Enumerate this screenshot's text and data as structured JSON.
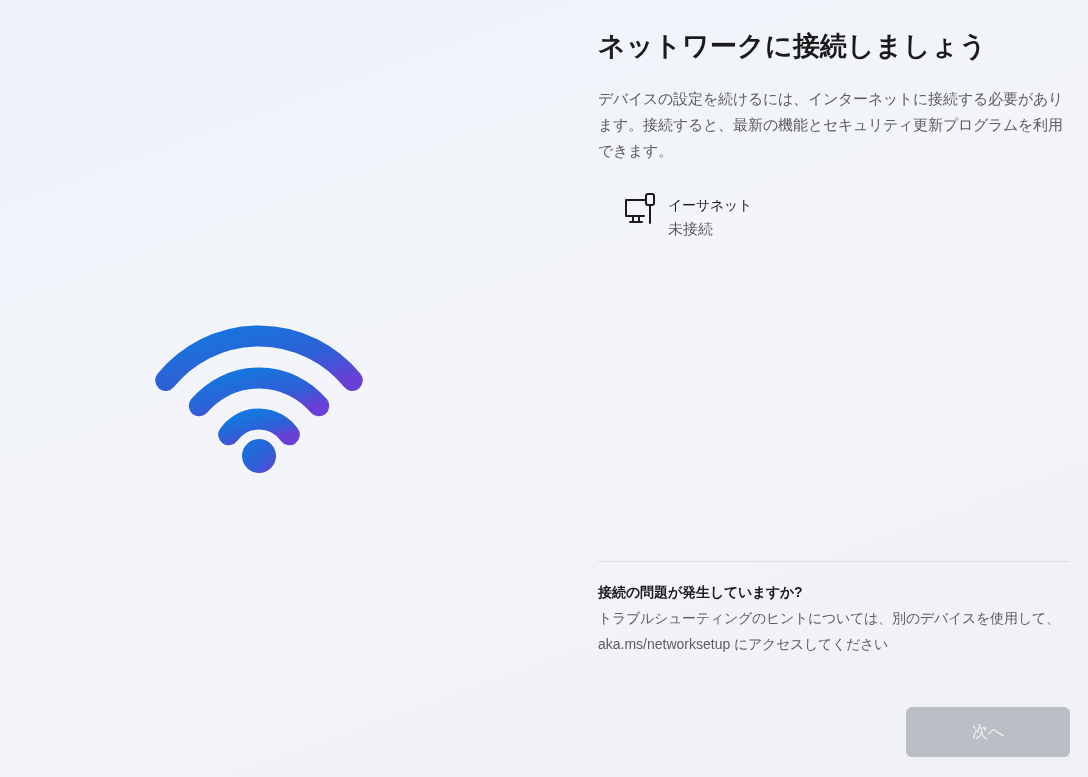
{
  "title": "ネットワークに接続しましょう",
  "description": "デバイスの設定を続けるには、インターネットに接続する必要があります。接続すると、最新の機能とセキュリティ更新プログラムを利用できます。",
  "networks": [
    {
      "kind": "ethernet",
      "name": "イーサネット",
      "status": "未接続"
    }
  ],
  "help": {
    "heading": "接続の問題が発生していますか?",
    "text": "トラブルシューティングのヒントについては、別のデバイスを使用して、aka.ms/networksetup にアクセスしてください"
  },
  "buttons": [
    {
      "label": "次へ",
      "disabled": true
    }
  ]
}
